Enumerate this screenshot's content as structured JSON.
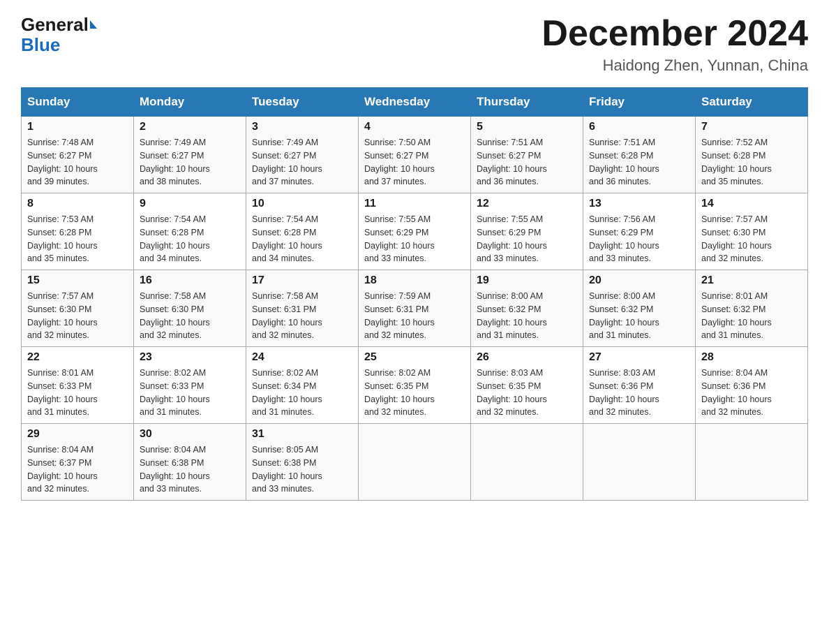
{
  "header": {
    "logo_general": "General",
    "logo_blue": "Blue",
    "month_title": "December 2024",
    "location": "Haidong Zhen, Yunnan, China"
  },
  "days_of_week": [
    "Sunday",
    "Monday",
    "Tuesday",
    "Wednesday",
    "Thursday",
    "Friday",
    "Saturday"
  ],
  "weeks": [
    [
      {
        "day": "1",
        "sunrise": "7:48 AM",
        "sunset": "6:27 PM",
        "daylight": "10 hours and 39 minutes."
      },
      {
        "day": "2",
        "sunrise": "7:49 AM",
        "sunset": "6:27 PM",
        "daylight": "10 hours and 38 minutes."
      },
      {
        "day": "3",
        "sunrise": "7:49 AM",
        "sunset": "6:27 PM",
        "daylight": "10 hours and 37 minutes."
      },
      {
        "day": "4",
        "sunrise": "7:50 AM",
        "sunset": "6:27 PM",
        "daylight": "10 hours and 37 minutes."
      },
      {
        "day": "5",
        "sunrise": "7:51 AM",
        "sunset": "6:27 PM",
        "daylight": "10 hours and 36 minutes."
      },
      {
        "day": "6",
        "sunrise": "7:51 AM",
        "sunset": "6:28 PM",
        "daylight": "10 hours and 36 minutes."
      },
      {
        "day": "7",
        "sunrise": "7:52 AM",
        "sunset": "6:28 PM",
        "daylight": "10 hours and 35 minutes."
      }
    ],
    [
      {
        "day": "8",
        "sunrise": "7:53 AM",
        "sunset": "6:28 PM",
        "daylight": "10 hours and 35 minutes."
      },
      {
        "day": "9",
        "sunrise": "7:54 AM",
        "sunset": "6:28 PM",
        "daylight": "10 hours and 34 minutes."
      },
      {
        "day": "10",
        "sunrise": "7:54 AM",
        "sunset": "6:28 PM",
        "daylight": "10 hours and 34 minutes."
      },
      {
        "day": "11",
        "sunrise": "7:55 AM",
        "sunset": "6:29 PM",
        "daylight": "10 hours and 33 minutes."
      },
      {
        "day": "12",
        "sunrise": "7:55 AM",
        "sunset": "6:29 PM",
        "daylight": "10 hours and 33 minutes."
      },
      {
        "day": "13",
        "sunrise": "7:56 AM",
        "sunset": "6:29 PM",
        "daylight": "10 hours and 33 minutes."
      },
      {
        "day": "14",
        "sunrise": "7:57 AM",
        "sunset": "6:30 PM",
        "daylight": "10 hours and 32 minutes."
      }
    ],
    [
      {
        "day": "15",
        "sunrise": "7:57 AM",
        "sunset": "6:30 PM",
        "daylight": "10 hours and 32 minutes."
      },
      {
        "day": "16",
        "sunrise": "7:58 AM",
        "sunset": "6:30 PM",
        "daylight": "10 hours and 32 minutes."
      },
      {
        "day": "17",
        "sunrise": "7:58 AM",
        "sunset": "6:31 PM",
        "daylight": "10 hours and 32 minutes."
      },
      {
        "day": "18",
        "sunrise": "7:59 AM",
        "sunset": "6:31 PM",
        "daylight": "10 hours and 32 minutes."
      },
      {
        "day": "19",
        "sunrise": "8:00 AM",
        "sunset": "6:32 PM",
        "daylight": "10 hours and 31 minutes."
      },
      {
        "day": "20",
        "sunrise": "8:00 AM",
        "sunset": "6:32 PM",
        "daylight": "10 hours and 31 minutes."
      },
      {
        "day": "21",
        "sunrise": "8:01 AM",
        "sunset": "6:32 PM",
        "daylight": "10 hours and 31 minutes."
      }
    ],
    [
      {
        "day": "22",
        "sunrise": "8:01 AM",
        "sunset": "6:33 PM",
        "daylight": "10 hours and 31 minutes."
      },
      {
        "day": "23",
        "sunrise": "8:02 AM",
        "sunset": "6:33 PM",
        "daylight": "10 hours and 31 minutes."
      },
      {
        "day": "24",
        "sunrise": "8:02 AM",
        "sunset": "6:34 PM",
        "daylight": "10 hours and 31 minutes."
      },
      {
        "day": "25",
        "sunrise": "8:02 AM",
        "sunset": "6:35 PM",
        "daylight": "10 hours and 32 minutes."
      },
      {
        "day": "26",
        "sunrise": "8:03 AM",
        "sunset": "6:35 PM",
        "daylight": "10 hours and 32 minutes."
      },
      {
        "day": "27",
        "sunrise": "8:03 AM",
        "sunset": "6:36 PM",
        "daylight": "10 hours and 32 minutes."
      },
      {
        "day": "28",
        "sunrise": "8:04 AM",
        "sunset": "6:36 PM",
        "daylight": "10 hours and 32 minutes."
      }
    ],
    [
      {
        "day": "29",
        "sunrise": "8:04 AM",
        "sunset": "6:37 PM",
        "daylight": "10 hours and 32 minutes."
      },
      {
        "day": "30",
        "sunrise": "8:04 AM",
        "sunset": "6:38 PM",
        "daylight": "10 hours and 33 minutes."
      },
      {
        "day": "31",
        "sunrise": "8:05 AM",
        "sunset": "6:38 PM",
        "daylight": "10 hours and 33 minutes."
      },
      null,
      null,
      null,
      null
    ]
  ],
  "labels": {
    "sunrise": "Sunrise:",
    "sunset": "Sunset:",
    "daylight": "Daylight:"
  }
}
